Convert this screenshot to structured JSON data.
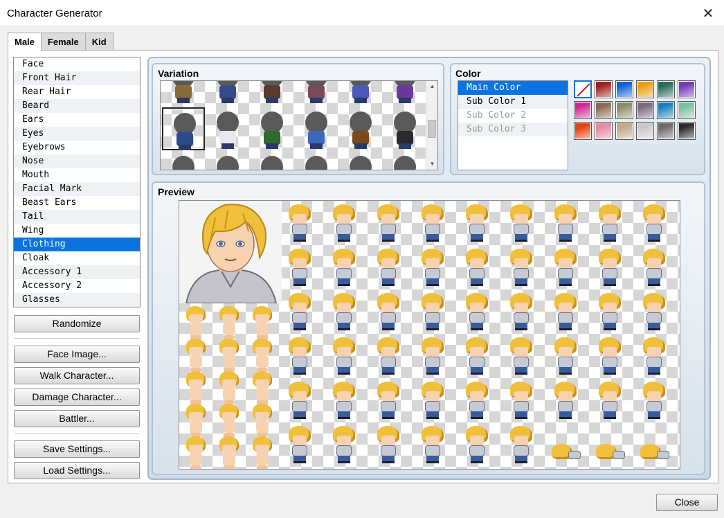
{
  "window": {
    "title": "Character Generator",
    "close_glyph": "✕"
  },
  "tabs": [
    {
      "label": "Male",
      "active": true
    },
    {
      "label": "Female",
      "active": false
    },
    {
      "label": "Kid",
      "active": false
    }
  ],
  "parts": [
    "Face",
    "Front Hair",
    "Rear Hair",
    "Beard",
    "Ears",
    "Eyes",
    "Eyebrows",
    "Nose",
    "Mouth",
    "Facial Mark",
    "Beast Ears",
    "Tail",
    "Wing",
    "Clothing",
    "Cloak",
    "Accessory 1",
    "Accessory 2",
    "Glasses"
  ],
  "selected_part": "Clothing",
  "buttons": {
    "randomize": "Randomize",
    "face_image": "Face Image...",
    "walk_character": "Walk Character...",
    "damage_character": "Damage Character...",
    "battler": "Battler...",
    "save_settings": "Save Settings...",
    "load_settings": "Load Settings...",
    "close": "Close"
  },
  "variation": {
    "title": "Variation",
    "top_colors": [
      "#8a6a3a",
      "#3a4a8a",
      "#5a3a2a",
      "#7a4a5a",
      "#4a5aba",
      "#6a3a9a"
    ],
    "mid_colors": [
      "#2a4a8a",
      "#e8e8f0",
      "#2e6a2e",
      "#3a6ab8",
      "#7a4a1a",
      "#2a2a2a"
    ],
    "selected_index": 0
  },
  "color": {
    "title": "Color",
    "slots": [
      {
        "label": "Main Color",
        "selected": true,
        "disabled": false
      },
      {
        "label": "Sub Color 1",
        "selected": false,
        "disabled": false
      },
      {
        "label": "Sub Color 2",
        "selected": false,
        "disabled": true
      },
      {
        "label": "Sub Color 3",
        "selected": false,
        "disabled": true
      }
    ],
    "swatches": [
      "none",
      "#a02020",
      "#1060d8",
      "#e8a010",
      "#2a6a5a",
      "#7a3ab8",
      "#d02890",
      "#8a6a50",
      "#8a8a6a",
      "#7a6a80",
      "#1a80c0",
      "#7ac0a0",
      "#e84010",
      "#e88aa0",
      "#c0a888",
      "#c8c8c8",
      "#6a6a6a",
      "#2a2a2a"
    ]
  },
  "preview": {
    "title": "Preview"
  }
}
